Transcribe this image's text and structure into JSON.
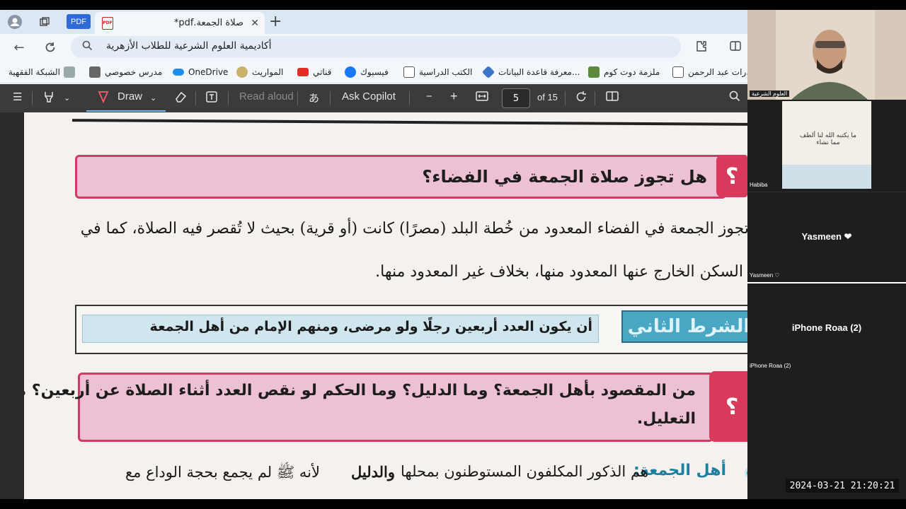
{
  "browser": {
    "tab_title": "صلاة الجمعة.pdf*",
    "pdf_chip": "PDF",
    "pdf_tab_icon": "PDF",
    "url": "أكاديمية العلوم الشرعية للطلاب الأزهرية",
    "favorites": [
      {
        "label": "الشبكة الفقهية",
        "icon": "bookmark-icon"
      },
      {
        "label": "مدرس خصوصي",
        "icon": "tutor-icon"
      },
      {
        "label": "OneDrive",
        "icon": "onedrive-icon"
      },
      {
        "label": "المواريث",
        "icon": "inheritance-icon"
      },
      {
        "label": "قناتي",
        "icon": "youtube-icon"
      },
      {
        "label": "فيسبوك",
        "icon": "facebook-icon"
      },
      {
        "label": "الكتب الدراسية",
        "icon": "document-icon"
      },
      {
        "label": "معرفة قاعدة البيانات...",
        "icon": "database-icon"
      },
      {
        "label": "ملزمة دوت كوم",
        "icon": "site-icon"
      },
      {
        "label": "رات عبد الرحمن...",
        "icon": "document-icon"
      }
    ]
  },
  "pdf_toolbar": {
    "draw": "Draw",
    "read_aloud": "Read aloud",
    "ask_copilot": "Ask Copilot",
    "minus": "−",
    "plus": "+",
    "page_current": "5",
    "page_total": "of 15"
  },
  "document": {
    "question1": "هل تجوز صلاة الجمعة في الفضاء؟",
    "q_mark": "؟",
    "answer_line1": "تجوز الجمعة في الفضاء المعدود من خُطة البلد (مصرًا) كانت (أو قرية) بحيث لا تُقصر فيه الصلاة، كما في",
    "answer_line2": "السكن الخارج عنها المعدود منها، بخلاف غير المعدود منها.",
    "condition_label": "الشرط الثاني",
    "condition_text": "أن يكون العدد أربعين رجلًا ولو مرضى، ومنهم الإمام من أهل الجمعة",
    "question2_line1": "من المقصود بأهل الجمعة؟ وما الدليل؟ وما الحكم لو نقص العدد أثناء الصلاة عن أربعين؟ مع",
    "question2_line2": "التعليل.",
    "ahl_label": "أهل الجمعة:",
    "ahl_text": "هم الذكور المكلفون المستوطنون بمحلها",
    "dalil_label": "والدليل",
    "dalil_text": "لأنه ﷺ لم يجمع بحجة الوداع مع"
  },
  "call": {
    "host_label": "العلوم الشرعية",
    "habiba_label": "Habiba",
    "habiba_card_text": "ما يكتبه الله لنا ألطف مما نشاء",
    "yasmeen_name": "Yasmeen ❤",
    "yasmeen_label": "Yasmeen ♡",
    "roaa_name": "iPhone Roaa (2)",
    "roaa_label": "iPhone Roaa (2)"
  },
  "timestamp": "2024-03-21  21:20:21",
  "colors": {
    "pink_banner": "#eec0d3",
    "pink_border": "#cc3a66",
    "teal": "#4aa7c4",
    "toolbar": "#3b3b3b"
  }
}
